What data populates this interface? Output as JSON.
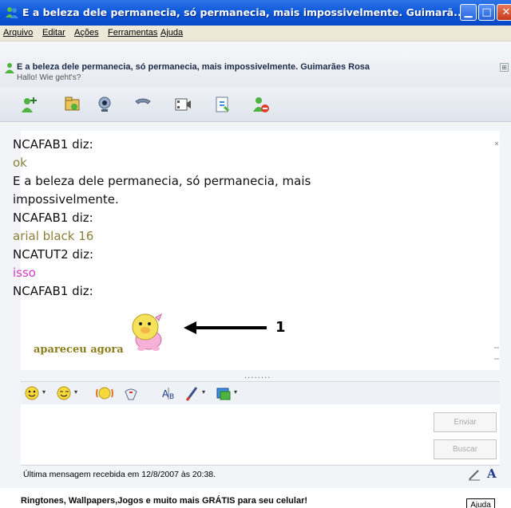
{
  "window": {
    "title": "E a beleza dele permanecia, só permanecia, mais impossivelmente. Guimarã...",
    "minimize_glyph": "▁",
    "maximize_glyph": "□",
    "close_glyph": "✕"
  },
  "menu": {
    "items": [
      "Arquivo",
      "Editar",
      "Ações",
      "Ferramentas",
      "Ajuda"
    ]
  },
  "contact": {
    "name": "E a beleza dele permanecia, só permanecia, mais impossivelmente. Guimarães Rosa",
    "personal_message": "Hallo! Wie geht's?",
    "expand_glyph": "⊞"
  },
  "toolbar": {
    "icons": [
      "invite-contact-icon",
      "send-files-icon",
      "webcam-icon",
      "call-icon",
      "video-icon",
      "activities-icon",
      "block-icon"
    ]
  },
  "conversation": {
    "lines": [
      {
        "text": "NCAFAB1 diz:",
        "kind": "nick"
      },
      {
        "text": "ok",
        "kind": "olive"
      },
      {
        "text": "E a beleza dele permanecia, só permanecia, mais",
        "kind": "black"
      },
      {
        "text": "impossivelmente.",
        "kind": "black"
      },
      {
        "text": "NCAFAB1 diz:",
        "kind": "nick"
      },
      {
        "text": "arial black 16",
        "kind": "olive"
      },
      {
        "text": "NCATUT2 diz:",
        "kind": "nick"
      },
      {
        "text": "isso",
        "kind": "pink"
      },
      {
        "text": "NCAFAB1 diz:",
        "kind": "nick"
      }
    ],
    "annotation_number": "1",
    "animated_text": "apareceu agora",
    "divider": "........"
  },
  "format_toolbar": {
    "icons": [
      "emoticon-icon",
      "wink-icon",
      "nudge-icon",
      "voice-clip-icon",
      "font-icon",
      "background-icon",
      "color-icon"
    ]
  },
  "input": {
    "send_label": "Enviar",
    "search_label": "Buscar"
  },
  "status": {
    "last_message": "Última mensagem recebida em 12/8/2007 às 20:38.",
    "font_glyph": "A"
  },
  "ad": {
    "text": "Ringtones, Wallpapers,Jogos e muito mais GRÁTIS para seu celular!",
    "help_label": "Ajuda"
  },
  "colors": {
    "title_bar": "#0b55d8",
    "olive_text": "#8c7f3c",
    "pink_text": "#d63cc7"
  }
}
